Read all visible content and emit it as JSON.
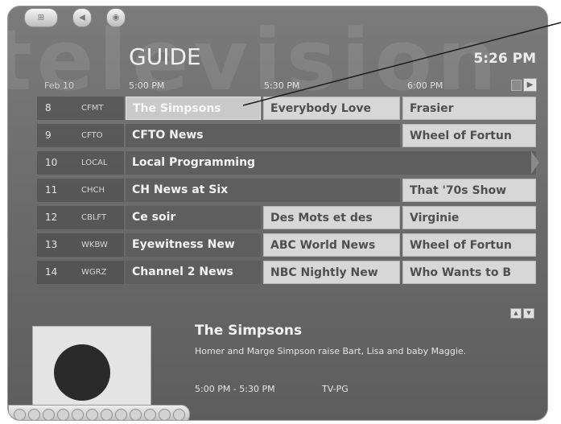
{
  "app": {
    "title": "GUIDE",
    "clock": "5:26 PM",
    "watermark": "television"
  },
  "guide": {
    "date": "Feb 10",
    "time_slots": [
      "5:00 PM",
      "5:30 PM",
      "6:00 PM"
    ],
    "channels": [
      {
        "number": "8",
        "callsign": "CFMT",
        "programs": [
          {
            "title": "The Simpsons",
            "selected": true
          },
          {
            "title": "Everybody Love"
          },
          {
            "title": "Frasier"
          }
        ]
      },
      {
        "number": "9",
        "callsign": "CFTO",
        "programs": [
          {
            "title": "CFTO News"
          },
          {
            "title": "Wheel of Fortun"
          }
        ]
      },
      {
        "number": "10",
        "callsign": "LOCAL",
        "programs": [
          {
            "title": "Local Programming"
          }
        ]
      },
      {
        "number": "11",
        "callsign": "CHCH",
        "programs": [
          {
            "title": "CH News at Six"
          },
          {
            "title": "That '70s Show"
          }
        ]
      },
      {
        "number": "12",
        "callsign": "CBLFT",
        "programs": [
          {
            "title": "Ce soir"
          },
          {
            "title": "Des Mots et des"
          },
          {
            "title": "Virginie"
          }
        ]
      },
      {
        "number": "13",
        "callsign": "WKBW",
        "programs": [
          {
            "title": "Eyewitness New"
          },
          {
            "title": "ABC World News"
          },
          {
            "title": "Wheel of Fortun"
          }
        ]
      },
      {
        "number": "14",
        "callsign": "WGRZ",
        "programs": [
          {
            "title": "Channel 2 News"
          },
          {
            "title": "NBC Nightly New"
          },
          {
            "title": "Who Wants to B"
          }
        ]
      }
    ]
  },
  "details": {
    "title": "The Simpsons",
    "description": "Homer and Marge Simpson raise Bart, Lisa and baby Maggie.",
    "time": "5:00 PM - 5:30 PM",
    "rating": "TV-PG"
  },
  "icons": {
    "scroll_up": "▲",
    "scroll_down": "▼",
    "page_next": "▶"
  }
}
